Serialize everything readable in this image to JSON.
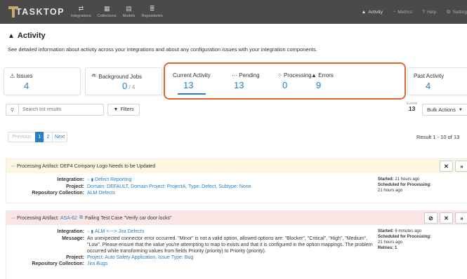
{
  "nav": {
    "brand": "TASKTOP",
    "items": [
      {
        "label": "Integrations",
        "icon": "arrows-icon",
        "glyph": "⇄"
      },
      {
        "label": "Collections",
        "icon": "box-icon",
        "glyph": "▦"
      },
      {
        "label": "Models",
        "icon": "document-icon",
        "glyph": "▤"
      },
      {
        "label": "Repositories",
        "icon": "database-icon",
        "glyph": "≣"
      }
    ],
    "right": [
      {
        "label": "Activity",
        "icon": "bell-icon",
        "glyph": "🔔"
      },
      {
        "label": "Metrics",
        "icon": "gauge-icon",
        "glyph": "◔"
      },
      {
        "label": "Help",
        "icon": "question-icon",
        "glyph": "?"
      },
      {
        "label": "Setting",
        "icon": "gear-icon",
        "glyph": "⚙"
      }
    ]
  },
  "page": {
    "title": "Activity",
    "subtitle": "See detailed information about activity across your integrations and about any configuration issues with your integration components."
  },
  "summary": {
    "issues": {
      "label": "Issues",
      "value": "4"
    },
    "background_jobs": {
      "label": "Background Jobs",
      "value": "0",
      "total": "/ 4"
    },
    "current_activity": {
      "label": "Current Activity",
      "value": "13"
    },
    "pending": {
      "label": "Pending",
      "value": "13"
    },
    "processing": {
      "label": "Processing",
      "value": "0"
    },
    "errors": {
      "label": "Errors",
      "value": "9"
    },
    "past_activity": {
      "label": "Past Activity",
      "value": "4"
    }
  },
  "toolbar": {
    "search_placeholder": "Search list results",
    "filters_label": "Filters",
    "events_label": "Events",
    "events_value": "13",
    "bulk_label": "Bulk Actions"
  },
  "pagination": {
    "prev": "Previous",
    "pages": [
      "1",
      "2"
    ],
    "active": "1",
    "next": "Next",
    "result": "Result 1 - 10 of 13"
  },
  "cards": [
    {
      "header": "··· Processing Artifact: DEF4 Company Logo Needs to be Updated",
      "integration": "Defect Reporting",
      "project": "Domain: DEFAULT, Domain Project: ProjectA, Type: Defect, Subtype: None",
      "repo_collection": "ALM Defects",
      "started": "Started:",
      "started_val": "21 hours ago",
      "scheduled": "Scheduled for Processing:",
      "scheduled_val": "21 hours ago"
    },
    {
      "header_prefix": "··· Processing Artifact:",
      "header_link": "ASA-62",
      "header_title": "Failing Test Case \"Verify car door locks\"",
      "integration": "ALM <---> Jira Defects",
      "message": "An unexpected connector error occurred. \"Minor\" is not a valid option, allowed options are: \"Blocker\", \"Critical\", \"High\", \"Medium\", \"Low\". Please ensure that the value you're attempting to map to exists and that it is configured in the option mappings. The problem occurred while transforming values from fields Priority (priority) to Priority (priority).",
      "project": "Project: Auto Safety Application, Issue Type: Bug",
      "repo_collection": "Jira Bugs",
      "started": "Started:",
      "started_val": "6 minutes ago",
      "scheduled": "Scheduled for Processing:",
      "scheduled_val": "21 hours ago",
      "retries": "Retries: 1"
    }
  ],
  "labels": {
    "integration": "Integration:",
    "project": "Project:",
    "repo_collection": "Repository Collection:",
    "message": "Message:"
  }
}
